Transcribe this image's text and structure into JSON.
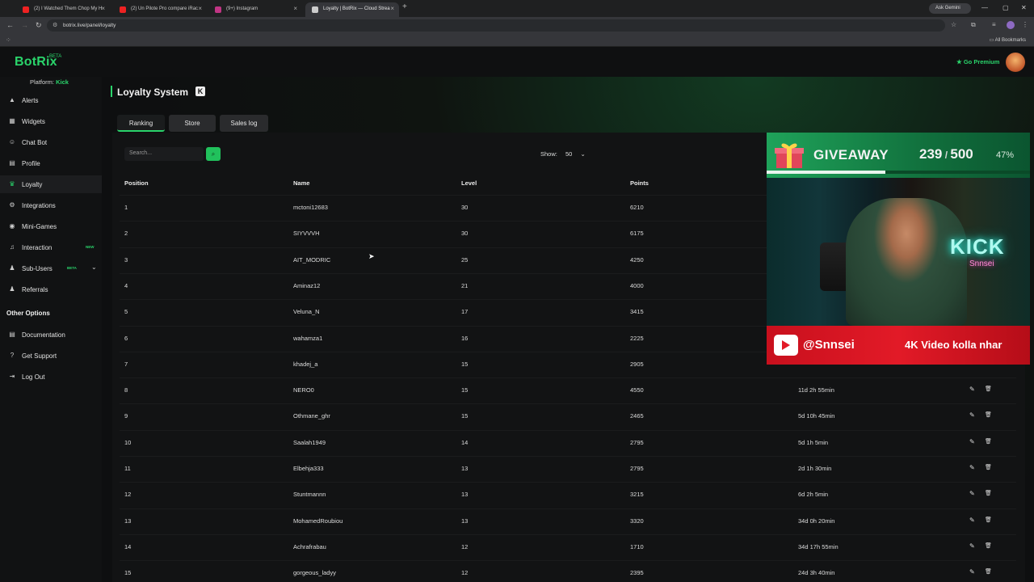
{
  "browser": {
    "tabs": [
      {
        "title": "(2) I Watched Them Chop My H",
        "fav": "#e22"
      },
      {
        "title": "(2) Un Pilote Pro compare iRac",
        "fav": "#e22"
      },
      {
        "title": "(9+) Instagram",
        "fav": "#c13584"
      },
      {
        "title": "Loyalty | BotRix — Cloud Strea",
        "fav": "#ccc"
      }
    ],
    "ask_gemini": "Ask Gemini",
    "url": "botrix.live/panel/loyalty",
    "all_bookmarks": "All Bookmarks"
  },
  "app": {
    "logo": "BotRix",
    "beta": "BETA",
    "go_premium": "Go Premium",
    "platform_label": "Platform:",
    "platform_value": "Kick"
  },
  "sidebar": {
    "items": [
      {
        "label": "Alerts",
        "icon": "warning-icon",
        "glyph": "▲"
      },
      {
        "label": "Widgets",
        "icon": "widgets-icon",
        "glyph": "▦"
      },
      {
        "label": "Chat Bot",
        "icon": "chatbot-icon",
        "glyph": "☺"
      },
      {
        "label": "Profile",
        "icon": "profile-icon",
        "glyph": "▤"
      },
      {
        "label": "Loyalty",
        "icon": "trophy-icon",
        "glyph": "♛"
      },
      {
        "label": "Integrations",
        "icon": "integrations-icon",
        "glyph": "⚙"
      },
      {
        "label": "Mini-Games",
        "icon": "gamepad-icon",
        "glyph": "◉"
      },
      {
        "label": "Interaction",
        "icon": "music-icon",
        "glyph": "♫"
      },
      {
        "label": "Sub-Users",
        "icon": "users-icon",
        "glyph": "♟"
      },
      {
        "label": "Referrals",
        "icon": "referrals-icon",
        "glyph": "♟"
      }
    ],
    "interaction_badge": "NEW",
    "subusers_badge": "BETA",
    "other_options": "Other Options",
    "other_items": [
      {
        "label": "Documentation",
        "icon": "document-icon",
        "glyph": "▤"
      },
      {
        "label": "Get Support",
        "icon": "help-icon",
        "glyph": "?"
      },
      {
        "label": "Log Out",
        "icon": "logout-icon",
        "glyph": "⇥"
      }
    ]
  },
  "page": {
    "title": "Loyalty System",
    "tabs": [
      "Ranking",
      "Store",
      "Sales log"
    ],
    "search_placeholder": "Search...",
    "show_label": "Show:",
    "show_value": "50"
  },
  "table": {
    "headers": [
      "Position",
      "Name",
      "Level",
      "Points"
    ],
    "rows": [
      {
        "pos": "1",
        "name": "mctoni12683",
        "level": "30",
        "points": "6210",
        "time": ""
      },
      {
        "pos": "2",
        "name": "SIYVVVH",
        "level": "30",
        "points": "6175",
        "time": ""
      },
      {
        "pos": "3",
        "name": "AIT_MODRIC",
        "level": "25",
        "points": "4250",
        "time": ""
      },
      {
        "pos": "4",
        "name": "Aminaz12",
        "level": "21",
        "points": "4000",
        "time": ""
      },
      {
        "pos": "5",
        "name": "Veluna_N",
        "level": "17",
        "points": "3415",
        "time": ""
      },
      {
        "pos": "6",
        "name": "wahamza1",
        "level": "16",
        "points": "2225",
        "time": ""
      },
      {
        "pos": "7",
        "name": "khadej_a",
        "level": "15",
        "points": "2905",
        "time": ""
      },
      {
        "pos": "8",
        "name": "NERO0",
        "level": "15",
        "points": "4550",
        "time": "11d 2h 55min"
      },
      {
        "pos": "9",
        "name": "Othmane_ghr",
        "level": "15",
        "points": "2465",
        "time": "5d 10h 45min"
      },
      {
        "pos": "10",
        "name": "Saalah1949",
        "level": "14",
        "points": "2795",
        "time": "5d 1h 5min"
      },
      {
        "pos": "11",
        "name": "Elbehja333",
        "level": "13",
        "points": "2795",
        "time": "2d 1h 30min"
      },
      {
        "pos": "12",
        "name": "Stuntmannn",
        "level": "13",
        "points": "3215",
        "time": "6d 2h 5min"
      },
      {
        "pos": "13",
        "name": "MohamedRoubiou",
        "level": "13",
        "points": "3320",
        "time": "34d 0h 20min"
      },
      {
        "pos": "14",
        "name": "Achrafrabau",
        "level": "12",
        "points": "1710",
        "time": "34d 17h 55min"
      },
      {
        "pos": "15",
        "name": "gorgeous_ladyy",
        "level": "12",
        "points": "2395",
        "time": "24d 3h 40min"
      }
    ]
  },
  "overlay": {
    "giveaway_label": "GIVEAWAY",
    "count": "239",
    "total": "500",
    "percent": "47%",
    "progress_fraction": 0.47,
    "youtube_handle": "@Snnsei",
    "slogan": "4K Video kolla nhar",
    "neon_text": "KICK",
    "neon_sub": "Snnsei"
  }
}
